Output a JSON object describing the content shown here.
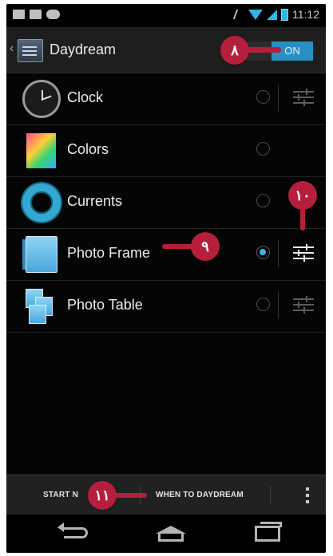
{
  "status_bar": {
    "time": "11:12"
  },
  "action_bar": {
    "title": "Daydream",
    "toggle_label": "ON"
  },
  "list": {
    "items": [
      {
        "label": "Clock",
        "icon": "clock-icon",
        "selected": false,
        "has_settings": true
      },
      {
        "label": "Colors",
        "icon": "colors-icon",
        "selected": false,
        "has_settings": false
      },
      {
        "label": "Currents",
        "icon": "currents-icon",
        "selected": false,
        "has_settings": false
      },
      {
        "label": "Photo Frame",
        "icon": "photo-frame-icon",
        "selected": true,
        "has_settings": true
      },
      {
        "label": "Photo Table",
        "icon": "photo-table-icon",
        "selected": false,
        "has_settings": true
      }
    ]
  },
  "button_bar": {
    "start_label": "START N",
    "when_label": "WHEN TO DAYDREAM"
  },
  "callouts": {
    "c8": "٨",
    "c9": "٩",
    "c10": "١٠",
    "c11": "١١"
  },
  "colors": {
    "accent": "#33b5e5",
    "toggle_on": "#2a8fc2",
    "callout": "#b51f3b"
  }
}
